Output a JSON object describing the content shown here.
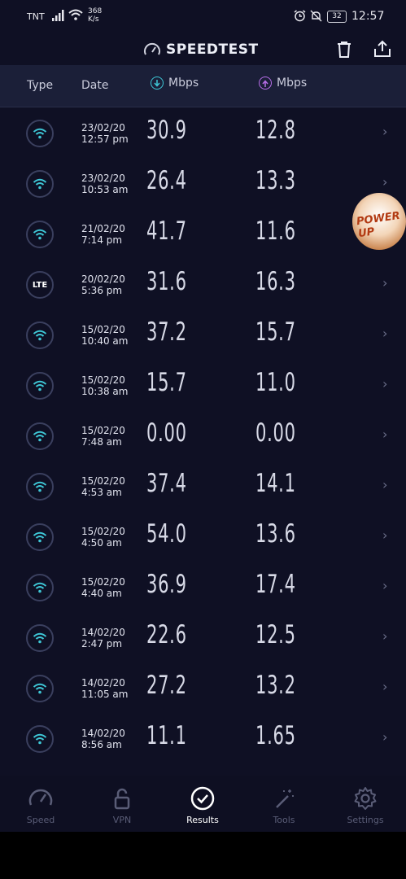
{
  "status_bar": {
    "carrier": "TNT",
    "net_speed_value": "368",
    "net_speed_unit": "K/s",
    "battery": "32",
    "time": "12:57"
  },
  "app": {
    "title": "SPEEDTEST"
  },
  "table": {
    "headers": {
      "type": "Type",
      "date": "Date",
      "download": "Mbps",
      "upload": "Mbps"
    },
    "rows": [
      {
        "type": "wifi",
        "date": "23/02/20",
        "time": "12:57 pm",
        "download": "30.9",
        "upload": "12.8"
      },
      {
        "type": "wifi",
        "date": "23/02/20",
        "time": "10:53 am",
        "download": "26.4",
        "upload": "13.3"
      },
      {
        "type": "wifi",
        "date": "21/02/20",
        "time": "7:14 pm",
        "download": "41.7",
        "upload": "11.6"
      },
      {
        "type": "lte",
        "type_label": "LTE",
        "date": "20/02/20",
        "time": "5:36 pm",
        "download": "31.6",
        "upload": "16.3"
      },
      {
        "type": "wifi",
        "date": "15/02/20",
        "time": "10:40 am",
        "download": "37.2",
        "upload": "15.7"
      },
      {
        "type": "wifi",
        "date": "15/02/20",
        "time": "10:38 am",
        "download": "15.7",
        "upload": "11.0"
      },
      {
        "type": "wifi",
        "date": "15/02/20",
        "time": "7:48 am",
        "download": "0.00",
        "upload": "0.00"
      },
      {
        "type": "wifi",
        "date": "15/02/20",
        "time": "4:53 am",
        "download": "37.4",
        "upload": "14.1"
      },
      {
        "type": "wifi",
        "date": "15/02/20",
        "time": "4:50 am",
        "download": "54.0",
        "upload": "13.6"
      },
      {
        "type": "wifi",
        "date": "15/02/20",
        "time": "4:40 am",
        "download": "36.9",
        "upload": "17.4"
      },
      {
        "type": "wifi",
        "date": "14/02/20",
        "time": "2:47 pm",
        "download": "22.6",
        "upload": "12.5"
      },
      {
        "type": "wifi",
        "date": "14/02/20",
        "time": "11:05 am",
        "download": "27.2",
        "upload": "13.2"
      },
      {
        "type": "wifi",
        "date": "14/02/20",
        "time": "8:56 am",
        "download": "11.1",
        "upload": "1.65"
      }
    ]
  },
  "overlay_badge": {
    "text": "POWER UP"
  },
  "nav": {
    "items": [
      {
        "label": "Speed",
        "icon": "speedometer-icon"
      },
      {
        "label": "VPN",
        "icon": "lock-icon"
      },
      {
        "label": "Results",
        "icon": "check-circle-icon",
        "active": true
      },
      {
        "label": "Tools",
        "icon": "wand-icon"
      },
      {
        "label": "Settings",
        "icon": "gear-icon"
      }
    ]
  },
  "colors": {
    "background": "#0f1024",
    "header_bg": "#1b1f38",
    "download_accent": "#3ec7d6",
    "upload_accent": "#b76ee8",
    "wifi_icon": "#3ec7d6"
  }
}
